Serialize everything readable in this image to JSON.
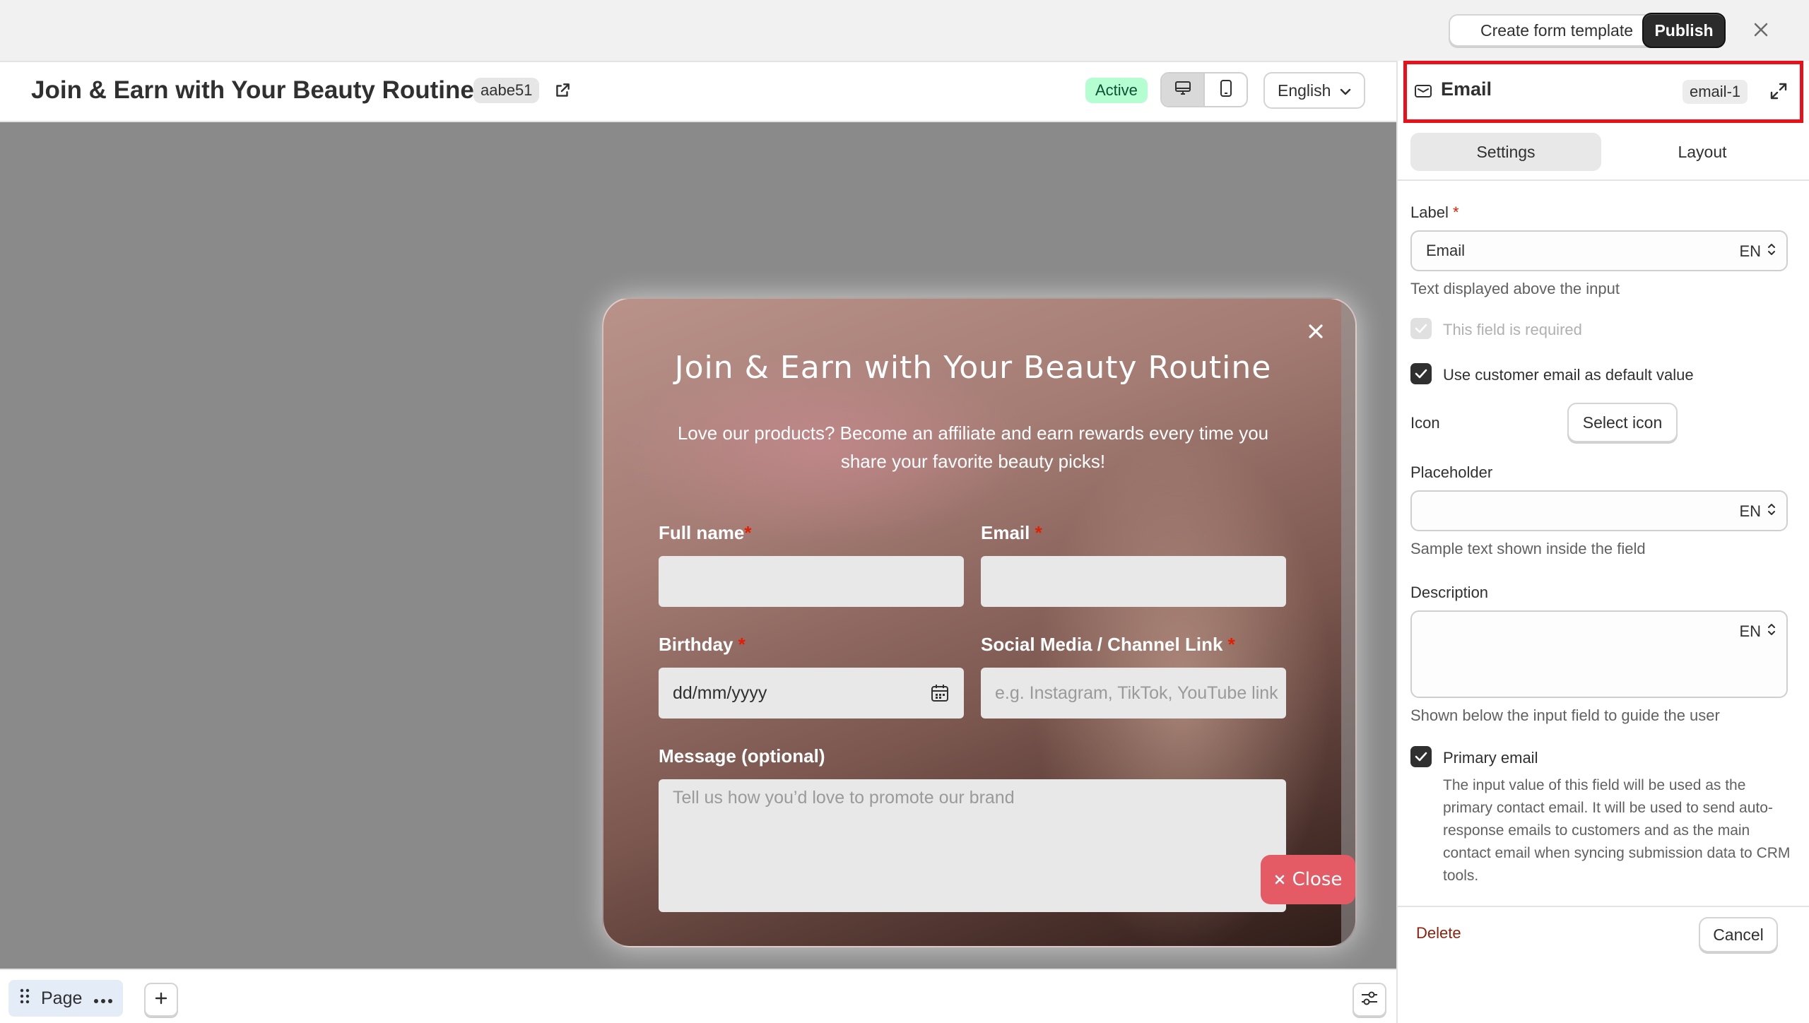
{
  "topbar": {
    "create_template_label": "Create form template",
    "publish_label": "Publish"
  },
  "header": {
    "title": "Join & Earn with Your Beauty Routine",
    "form_id": "aabe51",
    "status": "Active",
    "language": "English"
  },
  "popup": {
    "title": "Join & Earn with Your Beauty Routine",
    "subtitle": "Love our products? Become an affiliate and earn rewards every time you share your favorite beauty picks!",
    "fields": {
      "full_name_label": "Full name",
      "email_label": "Email",
      "birthday_label": "Birthday",
      "birthday_placeholder": "dd/mm/yyyy",
      "social_label": "Social Media / Channel Link",
      "social_placeholder": "e.g. Instagram, TikTok, YouTube link",
      "message_label": "Message (optional)",
      "message_placeholder": "Tell us how you’d love to promote our brand"
    },
    "required_mark": "*",
    "close_button_label": "Close"
  },
  "bottombar": {
    "page_label": "Page"
  },
  "panel": {
    "title": "Email",
    "element_id": "email-1",
    "tabs": [
      "Settings",
      "Layout"
    ],
    "selected_tab": "Settings",
    "label_field": {
      "label": "Label",
      "value": "Email",
      "locale": "EN",
      "help": "Text displayed above the input"
    },
    "required_checkbox": {
      "label": "This field is required",
      "checked": true,
      "disabled": true
    },
    "default_value_checkbox": {
      "label": "Use customer email as default value",
      "checked": true
    },
    "icon": {
      "label": "Icon",
      "button_label": "Select icon"
    },
    "placeholder_field": {
      "label": "Placeholder",
      "value": "",
      "locale": "EN",
      "help": "Sample text shown inside the field"
    },
    "description_field": {
      "label": "Description",
      "value": "",
      "locale": "EN",
      "help": "Shown below the input field to guide the user"
    },
    "primary_email": {
      "label": "Primary email",
      "checked": true,
      "description": "The input value of this field will be used as the primary contact email. It will be used to send auto-response emails to customers and as the main contact email when syncing submission data to CRM tools."
    },
    "delete_label": "Delete",
    "cancel_label": "Cancel"
  },
  "colors": {
    "accent_dark": "#2b2b2b",
    "active_badge_bg": "#b4fed2",
    "highlight_border": "#e8101a",
    "required_red": "#e51c00",
    "close_pill": "#e45b66",
    "delete_red": "#8e1f0b"
  }
}
